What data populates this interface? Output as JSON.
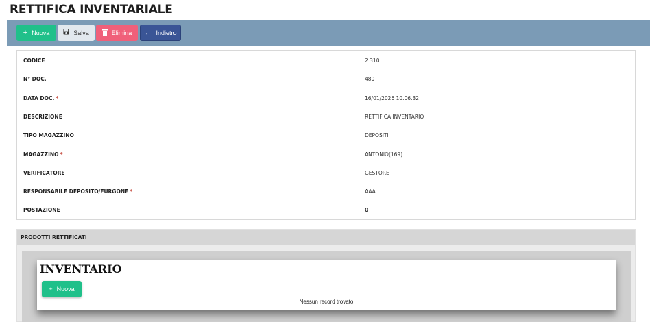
{
  "page": {
    "title": "RETTIFICA INVENTARIALE"
  },
  "toolbar": {
    "new_label": "Nuova",
    "save_label": "Salva",
    "delete_label": "Elimina",
    "back_label": "Indietro"
  },
  "form": {
    "fields": [
      {
        "label": "CODICE",
        "required": false,
        "value": "2.310"
      },
      {
        "label": "N° DOC.",
        "required": false,
        "value": "480"
      },
      {
        "label": "DATA DOC.",
        "required": true,
        "value": "16/01/2026 10.06.32"
      },
      {
        "label": "DESCRIZIONE",
        "required": false,
        "value": "RETTIFICA INVENTARIO"
      },
      {
        "label": "TIPO MAGAZZINO",
        "required": false,
        "value": "DEPOSITI"
      },
      {
        "label": "MAGAZZINO",
        "required": true,
        "value": "ANTONIO(169)"
      },
      {
        "label": "VERIFICATORE",
        "required": false,
        "value": "GESTORE"
      },
      {
        "label": "RESPONSABILE DEPOSITO/FURGONE",
        "required": true,
        "value": "AAA"
      },
      {
        "label": "POSTAZIONE",
        "required": false,
        "value": "0"
      }
    ],
    "required_mark": "*"
  },
  "products_section": {
    "title": "PRODOTTI RETTIFICATI",
    "card": {
      "title": "INVENTARIO",
      "new_label": "Nuova",
      "empty_text": "Nessun record trovato"
    }
  },
  "colors": {
    "toolbar_bg": "#7b9bb6",
    "new_button": "#20c08a",
    "save_button": "#e2e8ee",
    "delete_button": "#f0607a",
    "back_button": "#3a5596",
    "required_mark": "#c0392b"
  },
  "icons": {
    "new": "plus-icon",
    "save": "floppy-disk-icon",
    "delete": "trash-icon",
    "back": "arrow-left-icon"
  }
}
